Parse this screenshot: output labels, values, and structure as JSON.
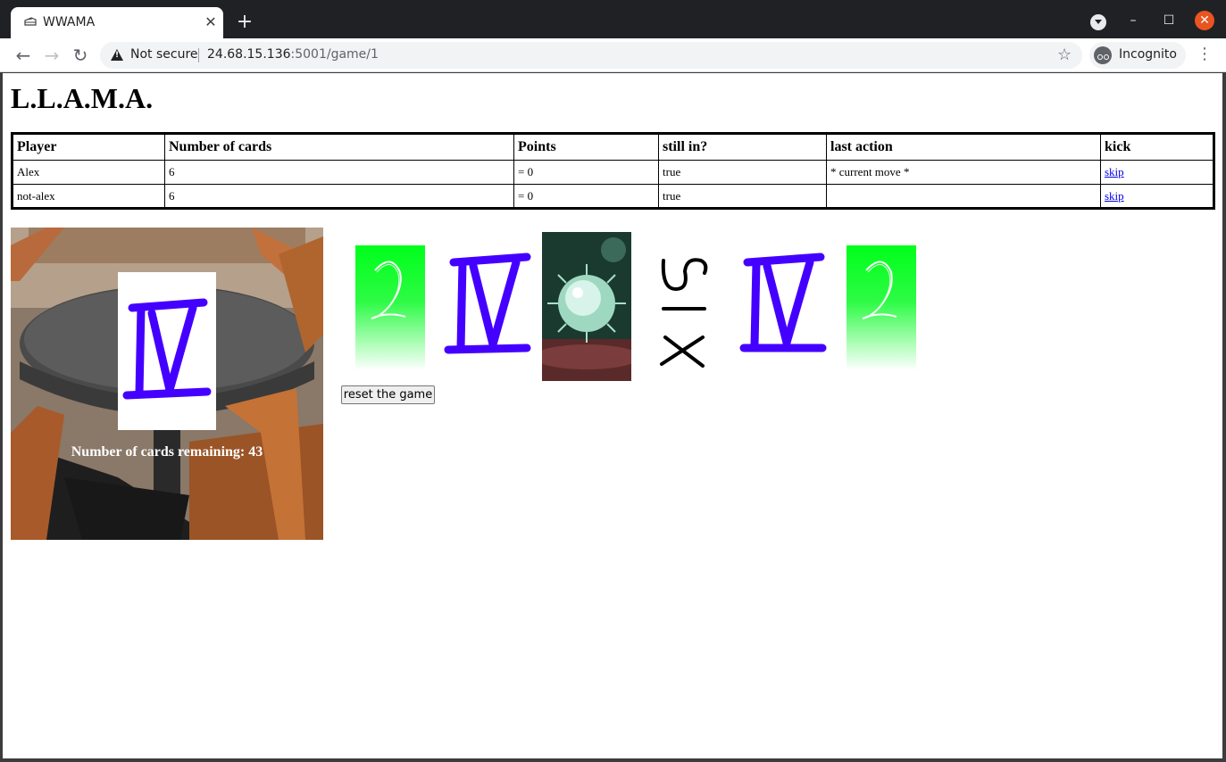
{
  "browser": {
    "tab_title": "WWAMA",
    "security_label": "Not secure",
    "url_host": "24.68.15.136",
    "url_path": ":5001/game/1",
    "profile_label": "Incognito"
  },
  "page": {
    "title": "L.L.A.M.A.",
    "table": {
      "headers": [
        "Player",
        "Number of cards",
        "Points",
        "still in?",
        "last action",
        "kick"
      ],
      "rows": [
        {
          "player": "Alex",
          "cards": "6",
          "points": "= 0",
          "still_in": "true",
          "last_action": "* current move *",
          "kick": "skip"
        },
        {
          "player": "not-alex",
          "cards": "6",
          "points": "= 0",
          "still_in": "true",
          "last_action": "",
          "kick": "skip"
        }
      ]
    },
    "deck": {
      "remaining_label": "Number of cards remaining: 43",
      "top_card": "IV"
    },
    "hand": {
      "cards": [
        "2",
        "IV",
        "virus",
        "5/x",
        "IV",
        "2"
      ]
    },
    "reset_label": "reset the game"
  }
}
